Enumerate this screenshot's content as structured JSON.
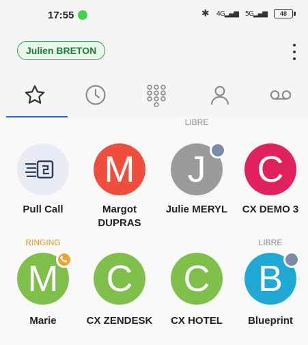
{
  "status_bar": {
    "time": "17:55",
    "battery": "48",
    "network_1": "4G",
    "network_2": "5G"
  },
  "header": {
    "user_name": "Julien BRETON"
  },
  "tabs": [
    {
      "icon": "star-icon"
    },
    {
      "icon": "clock-icon"
    },
    {
      "icon": "dialpad-icon"
    },
    {
      "icon": "person-icon"
    },
    {
      "icon": "voicemail-icon"
    }
  ],
  "contacts": [
    {
      "name": "Pull Call",
      "initial": "",
      "status_label": "",
      "color": "#e7ebf4"
    },
    {
      "name": "Margot DUPRAS",
      "initial": "M",
      "status_label": "",
      "color": "#ee4e3b"
    },
    {
      "name": "Julie MERYL",
      "initial": "J",
      "status_label": "LIBRE",
      "color": "#9a9a9a"
    },
    {
      "name": "CX DEMO 3",
      "initial": "C",
      "status_label": "",
      "color": "#e0215e"
    },
    {
      "name": "Marie",
      "initial": "M",
      "status_label": "RINGING",
      "color": "#7ec04a"
    },
    {
      "name": "CX ZENDESK",
      "initial": "C",
      "status_label": "",
      "color": "#7ec04a"
    },
    {
      "name": "CX HOTEL",
      "initial": "C",
      "status_label": "",
      "color": "#7ec04a"
    },
    {
      "name": "Blueprint",
      "initial": "B",
      "status_label": "LIBRE",
      "color": "#21a9d6"
    }
  ],
  "colors": {
    "accent": "#2a6fd6",
    "online": "#3ed34a",
    "libre": "#7b8bab",
    "ringing": "#f4a12c"
  }
}
